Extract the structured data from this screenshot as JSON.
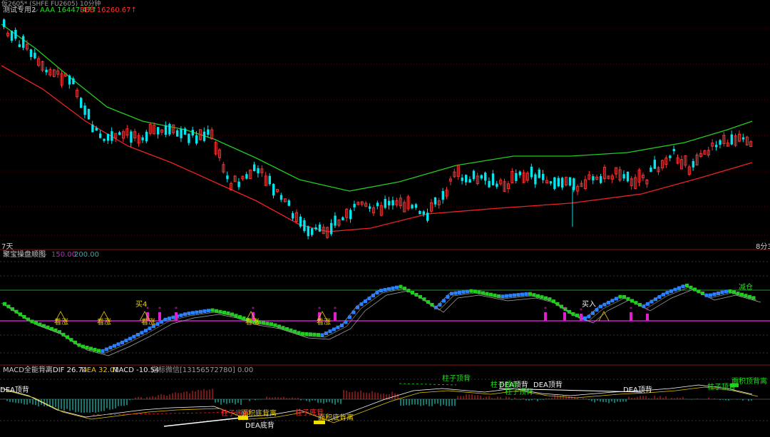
{
  "window_title": "仮2605* (SHFE FU2605)   10分钟",
  "main_panel": {
    "indicator_name": "测试专用2",
    "aaa_label": "AAA 16447.47↑",
    "bbb_label": "BBB 16260.67↑",
    "left_corner": "7天",
    "right_corner": "8分3"
  },
  "middle_panel": {
    "indicator_name": "聚宝操盘顺图",
    "value1": "150.00",
    "value2": "200.00",
    "label_kanzhang": "看涨",
    "label_buy4": "买4",
    "label_buyin": "买入",
    "label_jiancang": "减仓",
    "star": "*"
  },
  "macd_panel": {
    "indicator_name": "MACD全能背离",
    "dif": "DIF 26.74",
    "dea": "DEA 32.01",
    "macd": "MACD -10.54",
    "extra": "指标微信[13156572780] 0.00",
    "label_dea_top_div": "DEA顶背",
    "label_dea_bottom_div": "DEA底背",
    "label_area_bottom_div": "面积底背离",
    "label_area_top_div": "面积顶背离",
    "label_bar_top": "柱子顶背",
    "label_bar_bottom": "柱子底背"
  },
  "colors": {
    "up_candle": "#ff3333",
    "down_candle": "#00e5ee",
    "green_band": "#22cc22",
    "red_band": "#ee2222",
    "magenta": "#e01ed0",
    "macd_dif": "#ffffff",
    "macd_dea": "#e6c200"
  }
}
